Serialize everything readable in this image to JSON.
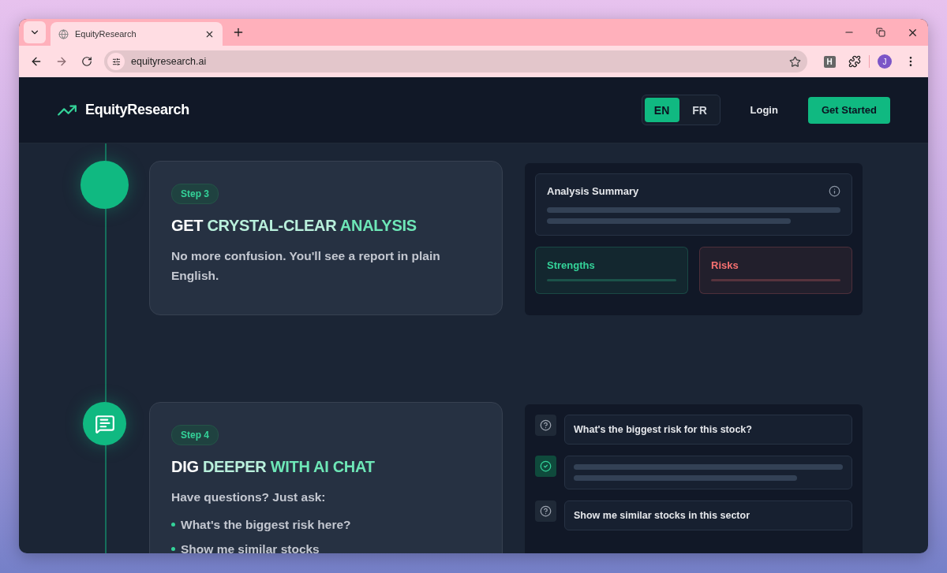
{
  "browser": {
    "tab_title": "EquityResearch",
    "url": "equityresearch.ai",
    "profile_initial": "J",
    "extension_letter": "H"
  },
  "header": {
    "brand": "EquityResearch",
    "languages": [
      {
        "label": "EN",
        "selected": true
      },
      {
        "label": "FR",
        "selected": false
      }
    ],
    "login": "Login",
    "cta": "Get Started"
  },
  "steps": [
    {
      "has_icon": false,
      "badge": "Step 3",
      "title": [
        {
          "text": "GET",
          "color": "#ffffff"
        },
        {
          "text": "CRYSTAL-CLEAR",
          "color": "#b9f0dc"
        },
        {
          "text": "ANALYSIS",
          "color": "#6ee7b7"
        }
      ],
      "body": "No more confusion. You'll see a report in plain English.",
      "preview": {
        "kind": "summary",
        "summary_title": "Analysis Summary",
        "tiles": [
          {
            "label": "Strengths",
            "color": "#34d399"
          },
          {
            "label": "Risks",
            "color": "#f87171"
          }
        ]
      }
    },
    {
      "has_icon": true,
      "badge": "Step 4",
      "title": [
        {
          "text": "DIG",
          "color": "#ffffff"
        },
        {
          "text": "DEEPER",
          "color": "#b9f0dc"
        },
        {
          "text": "WITH AI CHAT",
          "color": "#6ee7b7"
        }
      ],
      "body": "Have questions? Just ask:",
      "bullets": [
        "What's the biggest risk here?",
        "Show me similar stocks"
      ],
      "preview": {
        "kind": "chat",
        "messages": [
          {
            "kind": "question",
            "text": "What's the biggest risk for this stock?"
          },
          {
            "kind": "answer"
          },
          {
            "kind": "question",
            "text": "Show me similar stocks in this sector"
          }
        ]
      }
    }
  ]
}
